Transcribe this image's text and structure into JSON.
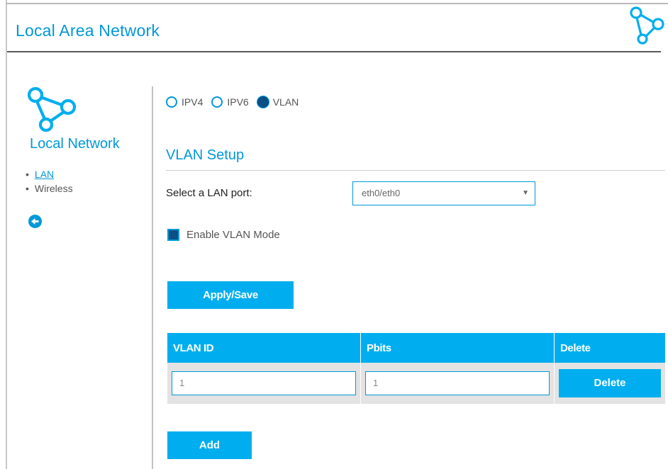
{
  "header": {
    "title": "Local Area Network",
    "logo_icon": "network-nodes-icon"
  },
  "sidebar": {
    "title": "Local Network",
    "logo_icon": "network-nodes-icon",
    "items": [
      {
        "label": "LAN",
        "active": true
      },
      {
        "label": "Wireless",
        "active": false
      }
    ],
    "back_icon": "arrow-left-circle-icon"
  },
  "mode": {
    "options": [
      {
        "label": "IPV4",
        "selected": false
      },
      {
        "label": "IPV6",
        "selected": false
      },
      {
        "label": "VLAN",
        "selected": true
      }
    ]
  },
  "vlan_setup": {
    "title": "VLAN Setup",
    "port_label": "Select a LAN port:",
    "port_value": "eth0/eth0",
    "enable_label": "Enable VLAN Mode",
    "enable_checked": true,
    "apply_label": "Apply/Save"
  },
  "table": {
    "headers": [
      "VLAN ID",
      "Pbits",
      "Delete"
    ],
    "rows": [
      {
        "vlan_id": "1",
        "pbits": "1",
        "delete_label": "Delete"
      }
    ],
    "add_label": "Add"
  },
  "colors": {
    "accent": "#00aeef",
    "accent_text": "#0099d8",
    "checked": "#0b4f84",
    "row_bg": "#e3e3e3"
  }
}
